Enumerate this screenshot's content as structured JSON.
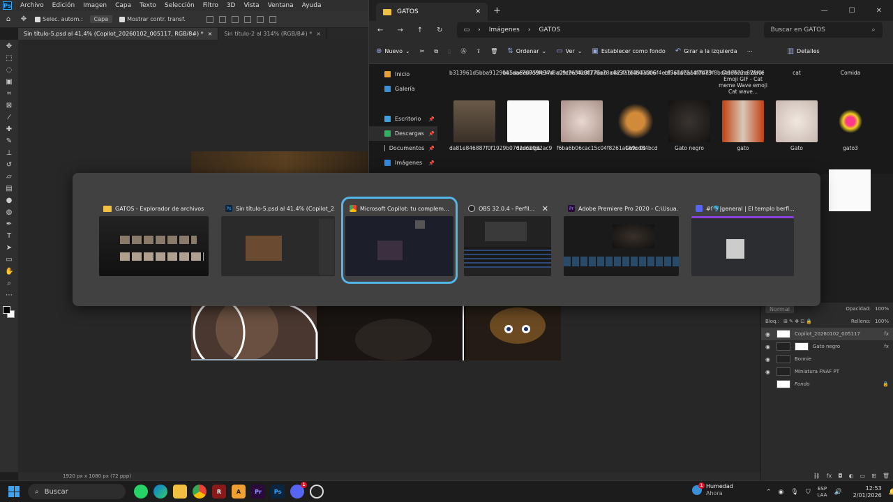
{
  "photoshop": {
    "menu": [
      "Archivo",
      "Edición",
      "Imagen",
      "Capa",
      "Texto",
      "Selección",
      "Filtro",
      "3D",
      "Vista",
      "Ventana",
      "Ayuda"
    ],
    "options": {
      "auto_select": "Selec. autom.:",
      "auto_select_target": "Capa",
      "show_transform": "Mostrar contr. transf."
    },
    "tabs": [
      "Sin título-5.psd al 41.4% (Copilot_20260102_005117, RGB/8#) *",
      "Sin título-2 al 314% (RGB/8#) *"
    ],
    "status": {
      "zoom": "%",
      "doc_size": "1920 px x 1080 px (72 ppp)"
    },
    "layers": {
      "blend_mode": "Normal",
      "opacity_label": "Opacidad:",
      "opacity": "100%",
      "lock_label": "Bloq.:",
      "fill_label": "Relleno:",
      "fill": "100%",
      "items": [
        "Copilot_20260102_005117",
        "Gato negro",
        "Bonnie",
        "Miniatura FNAF PT",
        "Fondo"
      ]
    }
  },
  "explorer": {
    "tab_title": "GATOS",
    "breadcrumb": [
      "Imágenes",
      "GATOS"
    ],
    "search_placeholder": "Buscar en GATOS",
    "commands": [
      "Nuevo",
      "Ordenar",
      "Ver",
      "Establecer como fondo",
      "Girar a la izquierda",
      "Detalles"
    ],
    "nav": [
      "Inicio",
      "Galería",
      "Escritorio",
      "Descargas",
      "Documentos",
      "Imágenes"
    ],
    "files_row1": [
      "b313961d5bba9129041aae7b8d9fe374",
      "bb5da8e0759494a8a09c9af4000776ab",
      "c2fd7634c8f170a78a4a5fabf4b47bb6",
      "c82377b393a006f4ebf5a1a75a4f7b73",
      "c876005a1d7f489f8bd466572c828f0f",
      "Cat Meme Wave Emoji GIF - Cat meme Wave emoji Cat wave...",
      "cat",
      "Comida"
    ],
    "files_row2": [
      "da81e846887f0f1929b0762d61032ac9",
      "descarga",
      "f6ba6b06cac15c04f8261a169cd84bcd",
      "Gato 01",
      "Gato negro",
      "gato",
      "Gato",
      "gato3"
    ]
  },
  "switcher": {
    "windows": [
      {
        "title": "GATOS - Explorador de archivos",
        "icon": "folder-icon"
      },
      {
        "title": "Sin título-5.psd al 41.4% (Copilot_2...",
        "icon": "photoshop-icon"
      },
      {
        "title": "Microsoft Copilot: tu complem...",
        "icon": "chrome-icon"
      },
      {
        "title": "OBS 32.0.4 - Perfil...",
        "icon": "obs-icon"
      },
      {
        "title": "Adobe Premiere Pro 2020 - C:\\Usua...",
        "icon": "premiere-icon"
      },
      {
        "title": "#ſ🐬|general | El templo berfl...",
        "icon": "discord-icon"
      }
    ]
  },
  "taskbar": {
    "search": "Buscar",
    "weather_title": "Humedad",
    "weather_sub": "Ahora",
    "lang_top": "ESP",
    "lang_bottom": "LAA",
    "time": "12:53",
    "date": "2/01/2026",
    "discord_badge": "1",
    "weather_badge": "1"
  },
  "colors": {
    "accent": "#52b6e8",
    "ps_blue": "#31a8ff",
    "premiere": "#9999ff"
  }
}
